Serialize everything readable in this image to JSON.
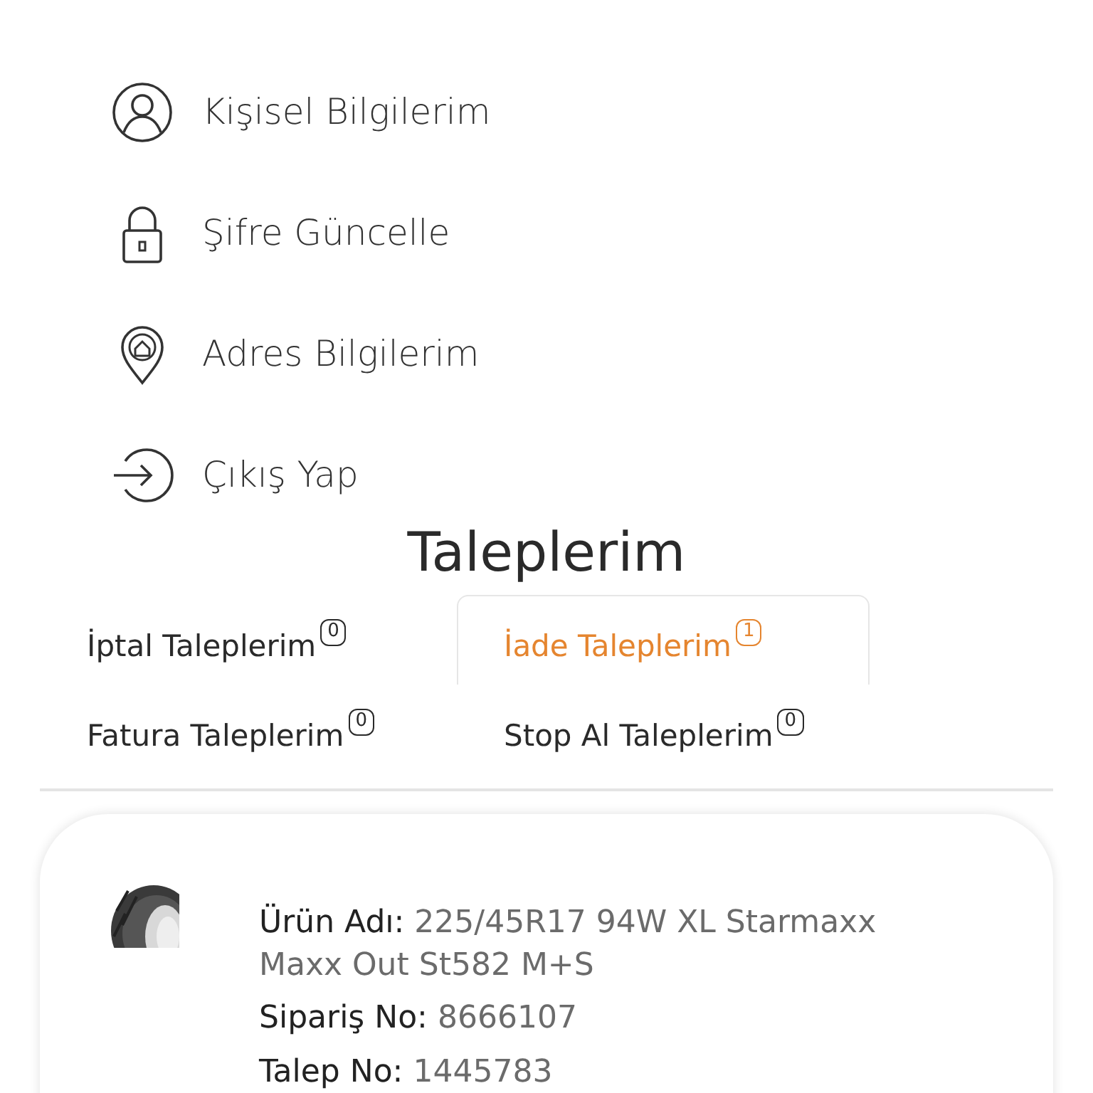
{
  "menu": [
    {
      "kind": "user",
      "label": "Kişisel Bilgilerim"
    },
    {
      "kind": "lock",
      "label": "Şifre Güncelle"
    },
    {
      "kind": "address",
      "label": "Adres Bilgilerim"
    },
    {
      "kind": "logout",
      "label": "Çıkış Yap"
    }
  ],
  "requests_title": "Taleplerim",
  "tabs": [
    {
      "label": "İptal Taleplerim",
      "count": "0",
      "selected": false
    },
    {
      "label": "İade Taleplerim",
      "count": "1",
      "selected": true
    },
    {
      "label": "Fatura Taleplerim",
      "count": "0",
      "selected": false
    },
    {
      "label": "Stop Al Taleplerim",
      "count": "0",
      "selected": false
    }
  ],
  "request_card": {
    "fields": [
      {
        "label": "Ürün Adı:",
        "value": "225/45R17 94W XL Starmaxx Maxx Out St582 M+S"
      },
      {
        "label": "Sipariş No:",
        "value": "8666107"
      },
      {
        "label": "Talep No:",
        "value": "1445783"
      }
    ]
  }
}
